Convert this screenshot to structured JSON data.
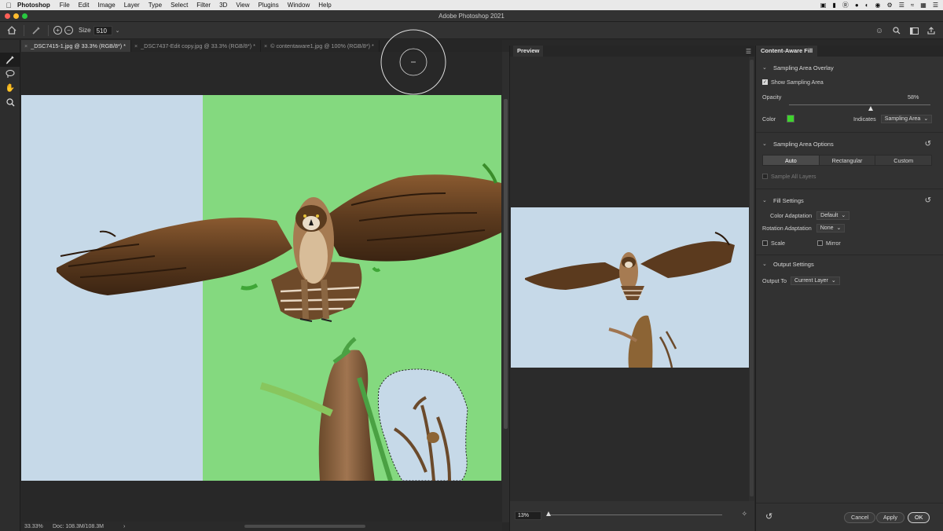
{
  "menubar": {
    "app_name": "Photoshop",
    "menus": [
      "File",
      "Edit",
      "Image",
      "Layer",
      "Type",
      "Select",
      "Filter",
      "3D",
      "View",
      "Plugins",
      "Window",
      "Help"
    ]
  },
  "window": {
    "title": "Adobe Photoshop 2021"
  },
  "options_bar": {
    "size_label": "Size",
    "size_value": "510"
  },
  "tabs": [
    {
      "label": "_DSC7415-1.jpg @ 33.3% (RGB/8*) *",
      "active": true
    },
    {
      "label": "_DSC7437-Edit copy.jpg @ 33.3% (RGB/8*) *",
      "active": false
    },
    {
      "label": "© contentaware1.jpg @ 100% (RGB/8*) *",
      "active": false
    }
  ],
  "status": {
    "zoom": "33.33%",
    "doc": "Doc: 108.3M/108.3M",
    "arrow": "›"
  },
  "preview": {
    "title": "Preview",
    "zoom": "13%"
  },
  "props": {
    "title": "Content-Aware Fill",
    "overlay": {
      "heading": "Sampling Area Overlay",
      "show_label": "Show Sampling Area",
      "opacity_label": "Opacity",
      "opacity_value": "58%",
      "opacity_fraction": 0.58,
      "color_label": "Color",
      "swatch_color": "#3fd42e",
      "indicates_label": "Indicates",
      "indicates_value": "Sampling Area"
    },
    "options": {
      "heading": "Sampling Area Options",
      "modes": [
        "Auto",
        "Rectangular",
        "Custom"
      ],
      "active_mode": "Auto",
      "sample_all": "Sample All Layers"
    },
    "fill": {
      "heading": "Fill Settings",
      "color_adapt_label": "Color Adaptation",
      "color_adapt_value": "Default",
      "rotation_label": "Rotation Adaptation",
      "rotation_value": "None",
      "scale_label": "Scale",
      "mirror_label": "Mirror"
    },
    "output": {
      "heading": "Output Settings",
      "output_label": "Output To",
      "output_value": "Current Layer"
    },
    "buttons": {
      "cancel": "Cancel",
      "apply": "Apply",
      "ok": "OK"
    }
  },
  "colors": {
    "overlay_green": "#84d97f",
    "sky": "#c5d9e8",
    "accent_swatch": "#3fd42e"
  }
}
